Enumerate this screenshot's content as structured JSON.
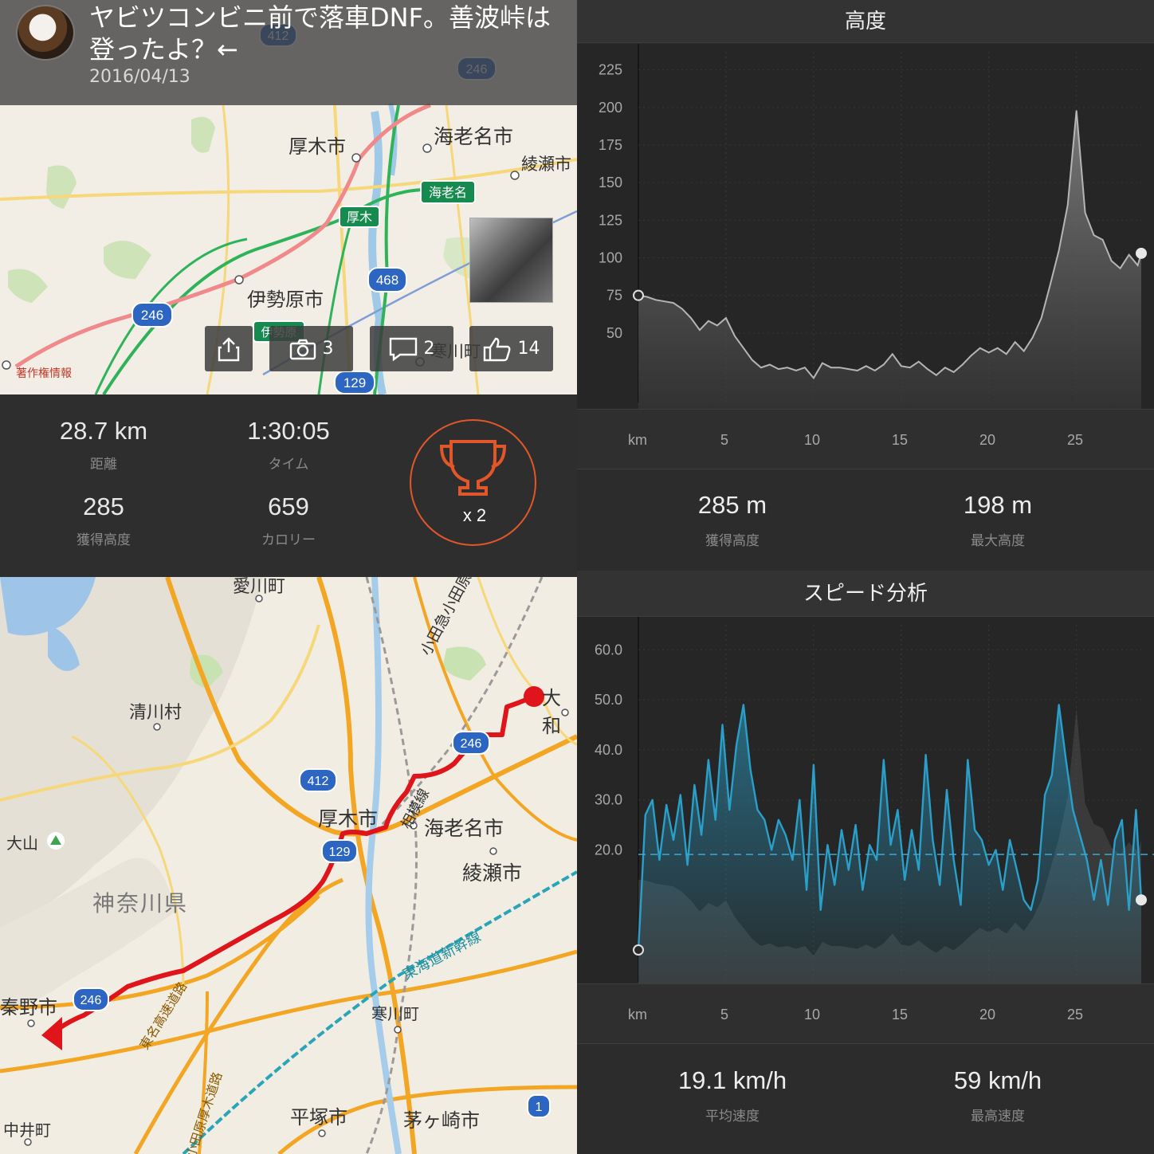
{
  "activity": {
    "title_line1": "ヤビツコンビニ前で落車DNF。善波峠は",
    "title_line2": "登ったよ？←",
    "date": "2016/04/13"
  },
  "map_top": {
    "labels": [
      "厚木市",
      "海老名市",
      "綾瀬市",
      "伊勢原市",
      "寒川町",
      "著作権情報"
    ],
    "road_badges": [
      "厚木",
      "海老名",
      "伊勢原",
      "468",
      "246",
      "129",
      "412",
      "246"
    ],
    "buttons": {
      "photos": "3",
      "comments": "2",
      "likes": "14"
    }
  },
  "stats": {
    "distance": {
      "value": "28.7 km",
      "label": "距離"
    },
    "time": {
      "value": "1:30:05",
      "label": "タイム"
    },
    "elevation_gain": {
      "value": "285",
      "label": "獲得高度"
    },
    "calories": {
      "value": "659",
      "label": "カロリー"
    },
    "trophy": {
      "count": "x 2"
    }
  },
  "elevation_panel": {
    "title": "高度",
    "x_unit": "km",
    "x_ticks": [
      "5",
      "10",
      "15",
      "20",
      "25"
    ],
    "y_ticks": [
      "225",
      "200",
      "175",
      "150",
      "125",
      "100",
      "75",
      "50"
    ],
    "gain": {
      "value": "285 m",
      "label": "獲得高度"
    },
    "max": {
      "value": "198 m",
      "label": "最大高度"
    }
  },
  "speed_panel": {
    "title": "スピード分析",
    "x_unit": "km",
    "x_ticks": [
      "5",
      "10",
      "15",
      "20",
      "25"
    ],
    "y_ticks": [
      "60.0",
      "50.0",
      "40.0",
      "30.0",
      "20.0"
    ],
    "avg": {
      "value": "19.1 km/h",
      "label": "平均速度"
    },
    "max": {
      "value": "59 km/h",
      "label": "最高速度"
    }
  },
  "map_bottom": {
    "labels": [
      "愛川町",
      "清川村",
      "厚木市",
      "海老名市",
      "綾瀬市",
      "大山",
      "神奈川県",
      "秦野市",
      "寒川町",
      "平塚市",
      "茅ヶ崎市",
      "中井町",
      "大和",
      "小田急小田原線",
      "東海道新幹線",
      "相模線",
      "東名高速道路",
      "小田原厚木道路"
    ],
    "road_badges": [
      "412",
      "129",
      "246",
      "246",
      "1"
    ]
  },
  "colors": {
    "accent_orange": "#e2572a",
    "route_red": "#e0141b",
    "speed_blue": "#2a9fc9",
    "elev_gray": "#8e8e8e"
  },
  "chart_data": [
    {
      "type": "area",
      "title": "高度",
      "xlabel": "km",
      "ylabel": "",
      "xlim": [
        0,
        28.7
      ],
      "ylim": [
        25,
        237
      ],
      "x": [
        0,
        0.5,
        1,
        1.5,
        2,
        2.5,
        3,
        3.5,
        4,
        4.5,
        5,
        5.5,
        6,
        6.5,
        7,
        7.5,
        8,
        8.5,
        9,
        9.5,
        10,
        10.5,
        11,
        11.5,
        12,
        12.5,
        13,
        13.5,
        14,
        14.5,
        15,
        15.5,
        16,
        16.5,
        17,
        17.5,
        18,
        18.5,
        19,
        19.5,
        20,
        20.5,
        21,
        21.5,
        22,
        22.5,
        23,
        23.5,
        24,
        24.5,
        25,
        25.5,
        26,
        26.5,
        27,
        27.5,
        28,
        28.5,
        28.7
      ],
      "values": [
        75,
        74,
        72,
        71,
        70,
        66,
        60,
        52,
        58,
        55,
        60,
        48,
        40,
        32,
        27,
        29,
        26,
        27,
        25,
        27,
        20,
        30,
        27,
        27,
        26,
        25,
        28,
        25,
        29,
        36,
        28,
        27,
        31,
        26,
        22,
        27,
        24,
        29,
        35,
        40,
        37,
        40,
        36,
        44,
        38,
        47,
        60,
        82,
        105,
        135,
        198,
        130,
        115,
        112,
        98,
        93,
        102,
        95,
        103
      ]
    },
    {
      "type": "line",
      "title": "スピード分析",
      "xlabel": "km",
      "ylabel": "",
      "xlim": [
        0,
        28.7
      ],
      "ylim": [
        0,
        65
      ],
      "average": 19.1,
      "x": [
        0,
        0.4,
        0.8,
        1.2,
        1.6,
        2,
        2.4,
        2.8,
        3.2,
        3.6,
        4,
        4.4,
        4.8,
        5.2,
        5.6,
        6,
        6.4,
        6.8,
        7.2,
        7.6,
        8,
        8.4,
        8.8,
        9.2,
        9.6,
        10,
        10.4,
        10.8,
        11.2,
        11.6,
        12,
        12.4,
        12.8,
        13.2,
        13.6,
        14,
        14.4,
        14.8,
        15.2,
        15.6,
        16,
        16.4,
        16.8,
        17.2,
        17.6,
        18,
        18.4,
        18.8,
        19.2,
        19.6,
        20,
        20.4,
        20.8,
        21.2,
        21.6,
        22,
        22.4,
        22.8,
        23.2,
        23.6,
        24,
        24.4,
        24.8,
        25.2,
        25.6,
        26,
        26.4,
        26.8,
        27.2,
        27.6,
        28,
        28.4,
        28.7
      ],
      "values": [
        0,
        27,
        30,
        18,
        29,
        22,
        31,
        17,
        33,
        23,
        38,
        26,
        45,
        28,
        41,
        49,
        36,
        28,
        26,
        20,
        26,
        23,
        18,
        30,
        12,
        37,
        8,
        21,
        13,
        24,
        16,
        25,
        12,
        21,
        18,
        38,
        21,
        28,
        14,
        24,
        16,
        39,
        22,
        13,
        32,
        18,
        9,
        38,
        24,
        22,
        17,
        20,
        12,
        22,
        16,
        10,
        8,
        14,
        31,
        35,
        49,
        38,
        28,
        23,
        18,
        10,
        18,
        9,
        22,
        26,
        8,
        28,
        10
      ]
    }
  ]
}
